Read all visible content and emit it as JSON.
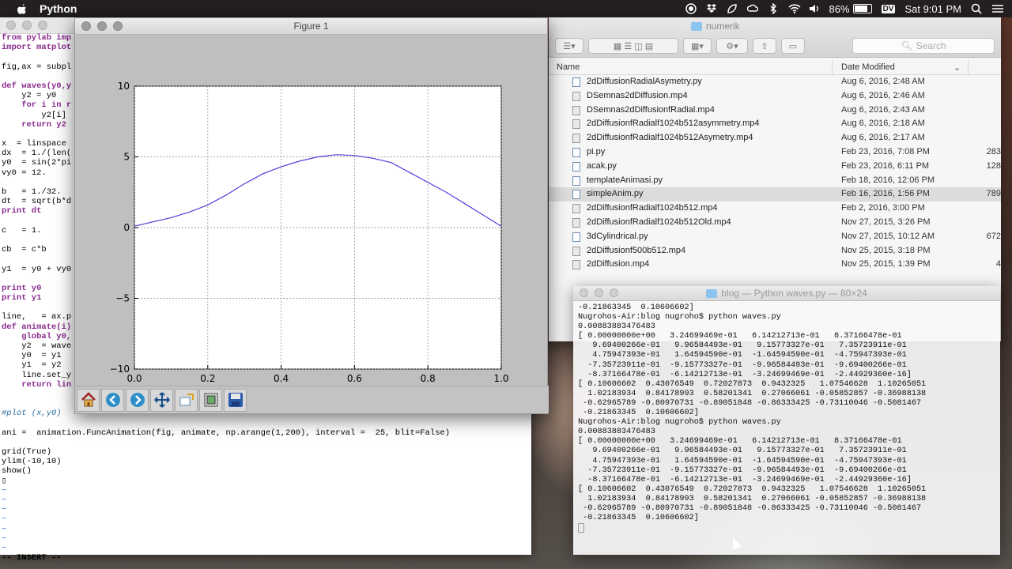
{
  "menubar": {
    "app_name": "Python",
    "battery": "86%",
    "input_badge": "DV",
    "clock": "Sat 9:01 PM"
  },
  "vim": {
    "lines": [
      {
        "t": "from pylab imp",
        "c": "kw"
      },
      {
        "t": "import matplot",
        "c": "kw"
      },
      {
        "t": "",
        "c": ""
      },
      {
        "t": "fig,ax = subpl",
        "c": ""
      },
      {
        "t": "",
        "c": ""
      },
      {
        "t": "def waves(y0,y",
        "c": "kw"
      },
      {
        "t": "    y2 = y0",
        "c": ""
      },
      {
        "t": "    for i in r",
        "c": "kw"
      },
      {
        "t": "        y2[i]",
        "c": ""
      },
      {
        "t": "    return y2",
        "c": "kw"
      },
      {
        "t": "",
        "c": ""
      },
      {
        "t": "x  = linspace",
        "c": ""
      },
      {
        "t": "dx  = 1./(len(",
        "c": ""
      },
      {
        "t": "y0  = sin(2*pi",
        "c": ""
      },
      {
        "t": "vy0 = 12.",
        "c": ""
      },
      {
        "t": "",
        "c": ""
      },
      {
        "t": "b   = 1./32.",
        "c": ""
      },
      {
        "t": "dt  = sqrt(b*d",
        "c": ""
      },
      {
        "t": "print dt",
        "c": "kw"
      },
      {
        "t": "",
        "c": ""
      },
      {
        "t": "c   = 1.",
        "c": ""
      },
      {
        "t": "",
        "c": ""
      },
      {
        "t": "cb  = c*b",
        "c": ""
      },
      {
        "t": "",
        "c": ""
      },
      {
        "t": "y1  = y0 + vy0",
        "c": ""
      },
      {
        "t": "",
        "c": ""
      },
      {
        "t": "print y0",
        "c": "kw"
      },
      {
        "t": "print y1",
        "c": "kw"
      },
      {
        "t": "",
        "c": ""
      },
      {
        "t": "line,   = ax.p",
        "c": ""
      },
      {
        "t": "def animate(i)",
        "c": "kw"
      },
      {
        "t": "    global y0,",
        "c": "kw"
      },
      {
        "t": "    y2  = wave",
        "c": ""
      },
      {
        "t": "    y0  = y1",
        "c": ""
      },
      {
        "t": "    y1  = y2",
        "c": ""
      },
      {
        "t": "    line.set_y",
        "c": ""
      },
      {
        "t": "    return lin",
        "c": "kw"
      },
      {
        "t": "",
        "c": ""
      },
      {
        "t": "",
        "c": ""
      },
      {
        "t": "#plot (x,y0)",
        "c": "cmt"
      },
      {
        "t": "",
        "c": ""
      },
      {
        "t": "ani =  animation.FuncAnimation(fig, animate, np.arange(1,200), interval =  25, blit=False)",
        "c": ""
      },
      {
        "t": "",
        "c": ""
      },
      {
        "t": "grid(True)",
        "c": ""
      },
      {
        "t": "ylim(-10,10)",
        "c": ""
      },
      {
        "t": "show()",
        "c": ""
      },
      {
        "t": "▯",
        "c": ""
      },
      {
        "t": "~",
        "c": "tilde"
      },
      {
        "t": "~",
        "c": "tilde"
      },
      {
        "t": "~",
        "c": "tilde"
      },
      {
        "t": "~",
        "c": "tilde"
      },
      {
        "t": "~",
        "c": "tilde"
      },
      {
        "t": "~",
        "c": "tilde"
      },
      {
        "t": "~",
        "c": "tilde"
      },
      {
        "t": "-- INSERT --",
        "c": "bold"
      }
    ]
  },
  "figure": {
    "title": "Figure 1",
    "toolbar": [
      "home-icon",
      "back-arrow-icon",
      "forward-arrow-icon",
      "pan-move-icon",
      "zoom-icon",
      "configure-subplots-icon",
      "save-disk-icon"
    ]
  },
  "chart_data": {
    "type": "line",
    "title": "",
    "xlabel": "",
    "ylabel": "",
    "xlim": [
      0.0,
      1.0
    ],
    "ylim": [
      -10,
      10
    ],
    "xticks": [
      "0.0",
      "0.2",
      "0.4",
      "0.6",
      "0.8",
      "1.0"
    ],
    "yticks": [
      "10",
      "5",
      "0",
      "−5",
      "−10"
    ],
    "grid": true,
    "series": [
      {
        "color": "#4a3fdc",
        "x": [
          0.0,
          0.05,
          0.1,
          0.15,
          0.2,
          0.25,
          0.3,
          0.35,
          0.4,
          0.45,
          0.5,
          0.55,
          0.6,
          0.65,
          0.7,
          0.75,
          0.8,
          0.85,
          0.9,
          0.95,
          1.0
        ],
        "y": [
          0.1,
          0.4,
          0.7,
          1.1,
          1.6,
          2.3,
          3.1,
          3.8,
          4.3,
          4.7,
          5.0,
          5.15,
          5.1,
          4.9,
          4.6,
          3.9,
          3.2,
          2.5,
          1.7,
          0.9,
          0.1
        ]
      }
    ]
  },
  "finder": {
    "title": "numerik",
    "search_placeholder": "Search",
    "col_name": "Name",
    "col_date": "Date Modified",
    "rows": [
      {
        "name": "2dDiffusionRadialAsymetry.py",
        "date": "Aug 6, 2016, 2:48 AM",
        "size": "",
        "kind": "py"
      },
      {
        "name": "DSemnas2dDiffusion.mp4",
        "date": "Aug 6, 2016, 2:46 AM",
        "size": "",
        "kind": "mp4"
      },
      {
        "name": "DSemnas2dDiffusionfRadial.mp4",
        "date": "Aug 6, 2016, 2:43 AM",
        "size": "",
        "kind": "mp4"
      },
      {
        "name": "2dDiffusionfRadialf1024b512asymmetry.mp4",
        "date": "Aug 6, 2016, 2:18 AM",
        "size": "",
        "kind": "mp4"
      },
      {
        "name": "2dDiffusionfRadialf1024b512Asymetry.mp4",
        "date": "Aug 6, 2016, 2:17 AM",
        "size": "",
        "kind": "mp4"
      },
      {
        "name": "pi.py",
        "date": "Feb 23, 2016, 7:08 PM",
        "size": "283",
        "kind": "py"
      },
      {
        "name": "acak.py",
        "date": "Feb 23, 2016, 6:11 PM",
        "size": "128",
        "kind": "py"
      },
      {
        "name": "templateAnimasi.py",
        "date": "Feb 18, 2016, 12:06 PM",
        "size": "",
        "kind": "py"
      },
      {
        "name": "simpleAnim.py",
        "date": "Feb 16, 2016, 1:56 PM",
        "size": "789",
        "kind": "py",
        "sel": true
      },
      {
        "name": "2dDiffusionfRadialf1024b512.mp4",
        "date": "Feb 2, 2016, 3:00 PM",
        "size": "",
        "kind": "mp4"
      },
      {
        "name": "2dDiffusionfRadialf1024b512Old.mp4",
        "date": "Nov 27, 2015, 3:26 PM",
        "size": "",
        "kind": "mp4"
      },
      {
        "name": "3dCylindrical.py",
        "date": "Nov 27, 2015, 10:12 AM",
        "size": "672",
        "kind": "py"
      },
      {
        "name": "2dDiffusionf500b512.mp4",
        "date": "Nov 25, 2015, 3:18 PM",
        "size": "",
        "kind": "mp4"
      },
      {
        "name": "2dDiffusion.mp4",
        "date": "Nov 25, 2015, 1:39 PM",
        "size": "4",
        "kind": "mp4"
      }
    ]
  },
  "terminal": {
    "title": "blog — Python waves.py — 80×24",
    "lines": [
      "-0.21863345  0.10606602]",
      "Nugrohos-Air:blog nugroho$ python waves.py",
      "0.00883883476483",
      "[ 0.00000000e+00   3.24699469e-01   6.14212713e-01   8.37166478e-01",
      "   9.69400266e-01   9.96584493e-01   9.15773327e-01   7.35723911e-01",
      "   4.75947393e-01   1.64594590e-01  -1.64594590e-01  -4.75947393e-01",
      "  -7.35723911e-01  -9.15773327e-01  -9.96584493e-01  -9.69400266e-01",
      "  -8.37166478e-01  -6.14212713e-01  -3.24699469e-01  -2.44929360e-16]",
      "[ 0.10606602  0.43076549  0.72027873  0.9432325   1.07546628  1.10265051",
      "  1.02183934  0.84178993  0.58201341  0.27066061 -0.05852857 -0.36988138",
      " -0.62965789 -0.80970731 -0.89051848 -0.86333425 -0.73110046 -0.5081467",
      " -0.21863345  0.10606602]",
      "Nugrohos-Air:blog nugroho$ python waves.py",
      "0.00883883476483",
      "[ 0.00000000e+00   3.24699469e-01   6.14212713e-01   8.37166478e-01",
      "   9.69400266e-01   9.96584493e-01   9.15773327e-01   7.35723911e-01",
      "   4.75947393e-01   1.64594590e-01  -1.64594590e-01  -4.75947393e-01",
      "  -7.35723911e-01  -9.15773327e-01  -9.96584493e-01  -9.69400266e-01",
      "  -8.37166478e-01  -6.14212713e-01  -3.24699469e-01  -2.44929360e-16]",
      "[ 0.10606602  0.43076549  0.72027873  0.9432325   1.07546628  1.10265051",
      "  1.02183934  0.84178993  0.58201341  0.27066061 -0.05852857 -0.36988138",
      " -0.62965789 -0.80970731 -0.89051848 -0.86333425 -0.73110046 -0.5081467",
      " -0.21863345  0.10606602]"
    ]
  }
}
